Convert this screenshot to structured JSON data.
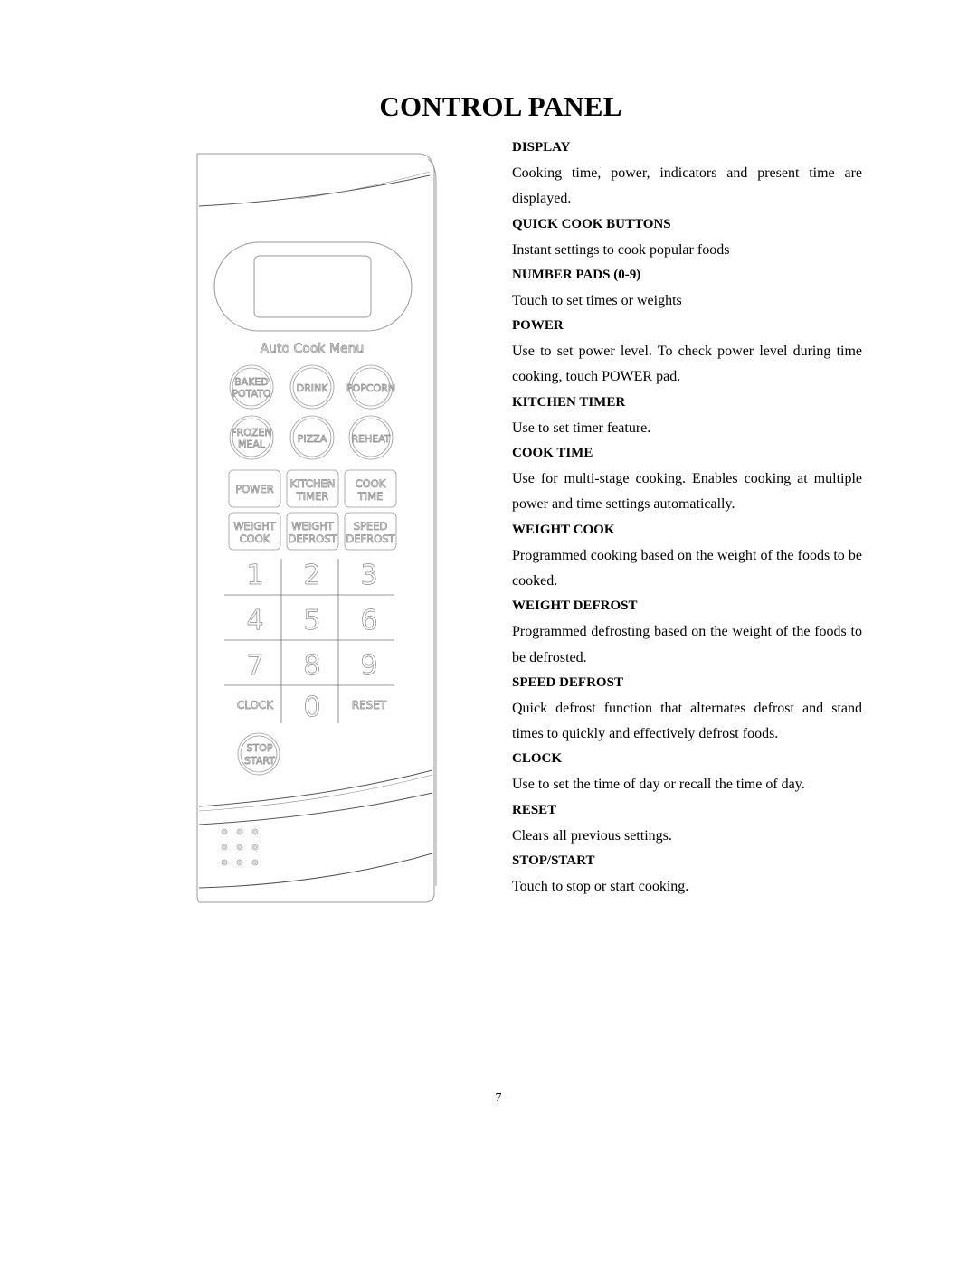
{
  "page": {
    "title": "CONTROL PANEL",
    "page_number": "7"
  },
  "panel": {
    "auto_cook_label": "Auto Cook Menu",
    "quick_cook": [
      {
        "line1": "BAKED",
        "line2": "POTATO"
      },
      {
        "line1": "DRINK",
        "line2": ""
      },
      {
        "line1": "POPCORN",
        "line2": ""
      },
      {
        "line1": "FROZEN",
        "line2": "MEAL"
      },
      {
        "line1": "PIZZA",
        "line2": ""
      },
      {
        "line1": "REHEAT",
        "line2": ""
      }
    ],
    "function_pads": [
      {
        "line1": "POWER",
        "line2": ""
      },
      {
        "line1": "KITCHEN",
        "line2": "TIMER"
      },
      {
        "line1": "COOK",
        "line2": "TIME"
      },
      {
        "line1": "WEIGHT",
        "line2": "COOK"
      },
      {
        "line1": "WEIGHT",
        "line2": "DEFROST"
      },
      {
        "line1": "SPEED",
        "line2": "DEFROST"
      }
    ],
    "number_pads": [
      "1",
      "2",
      "3",
      "4",
      "5",
      "6",
      "7",
      "8",
      "9",
      "CLOCK",
      "0",
      "RESET"
    ],
    "stop_start": {
      "line1": "STOP",
      "line2": "START"
    }
  },
  "descriptions": [
    {
      "heading": "DISPLAY",
      "text": "Cooking time, power, indicators and present time are displayed."
    },
    {
      "heading": "QUICK COOK BUTTONS",
      "text": "Instant settings to cook popular foods"
    },
    {
      "heading": "NUMBER PADS (0-9)",
      "text": "Touch to set times or weights"
    },
    {
      "heading": "POWER",
      "text": "Use to set power level. To check power level during time cooking, touch POWER pad."
    },
    {
      "heading": "KITCHEN TIMER",
      "text": "Use to set timer feature."
    },
    {
      "heading": "COOK TIME",
      "text": "Use for multi-stage cooking.  Enables cooking at multiple power and time settings automatically."
    },
    {
      "heading": "WEIGHT COOK",
      "text": "Programmed cooking based on the weight of the foods to be cooked."
    },
    {
      "heading": "WEIGHT DEFROST",
      "text": "Programmed defrosting based on the weight of the foods to be defrosted."
    },
    {
      "heading": "SPEED DEFROST",
      "text": "Quick defrost function that alternates defrost and stand times to quickly and effectively defrost foods."
    },
    {
      "heading": "CLOCK",
      "text": "Use to set the time of day or recall the time of day."
    },
    {
      "heading": "RESET",
      "text": "Clears all previous settings."
    },
    {
      "heading": "STOP/START",
      "text": "Touch to stop or start cooking."
    }
  ]
}
